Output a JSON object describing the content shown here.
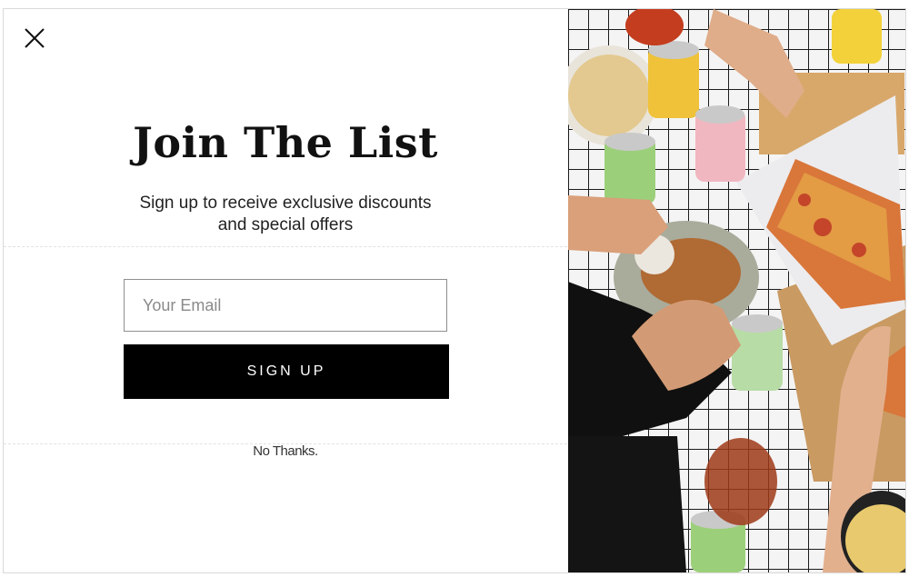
{
  "popup": {
    "title": "Join The List",
    "subtitle_line1": "Sign up to receive exclusive discounts",
    "subtitle_line2": "and special offers",
    "email": {
      "placeholder": "Your Email",
      "value": ""
    },
    "signup_label": "SIGN UP",
    "decline_label": "No Thanks.",
    "close_icon": "close-icon",
    "accent_color": "#000000"
  },
  "image": {
    "description_icon": "food-table-photo",
    "colors": [
      "#111111",
      "#e8c15a",
      "#c9482b",
      "#f2f2f2"
    ]
  }
}
